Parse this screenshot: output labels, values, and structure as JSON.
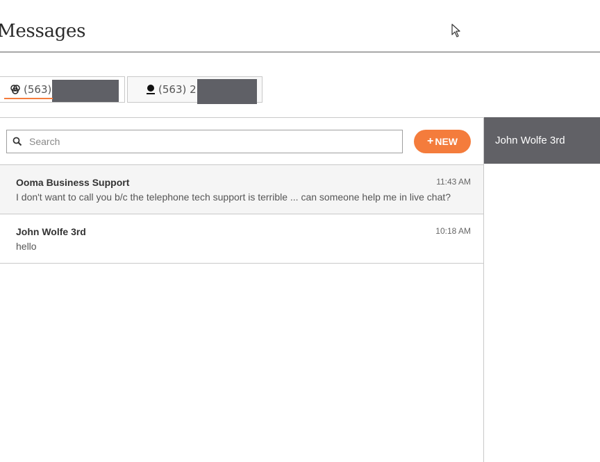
{
  "page": {
    "title": "Messages"
  },
  "tabs": [
    {
      "number_prefix": "(563)",
      "icon": "group-icon",
      "redacted": true,
      "active": true
    },
    {
      "number_prefix": "(563) 2",
      "icon": "person-icon",
      "redacted": true,
      "active": false
    }
  ],
  "search": {
    "placeholder": "Search",
    "value": ""
  },
  "new_button": {
    "label": "NEW",
    "icon": "plus-icon"
  },
  "conversations": [
    {
      "name": "Ooma Business Support",
      "time": "11:43 AM",
      "preview": "I don't want to call you b/c the telephone tech support is terrible ... can someone help me in live chat?"
    },
    {
      "name": "John Wolfe 3rd",
      "time": "10:18 AM",
      "preview": "hello"
    }
  ],
  "detail": {
    "contact_name": "John Wolfe 3rd"
  },
  "colors": {
    "accent": "#f47c3c",
    "header_bg": "#616166"
  }
}
